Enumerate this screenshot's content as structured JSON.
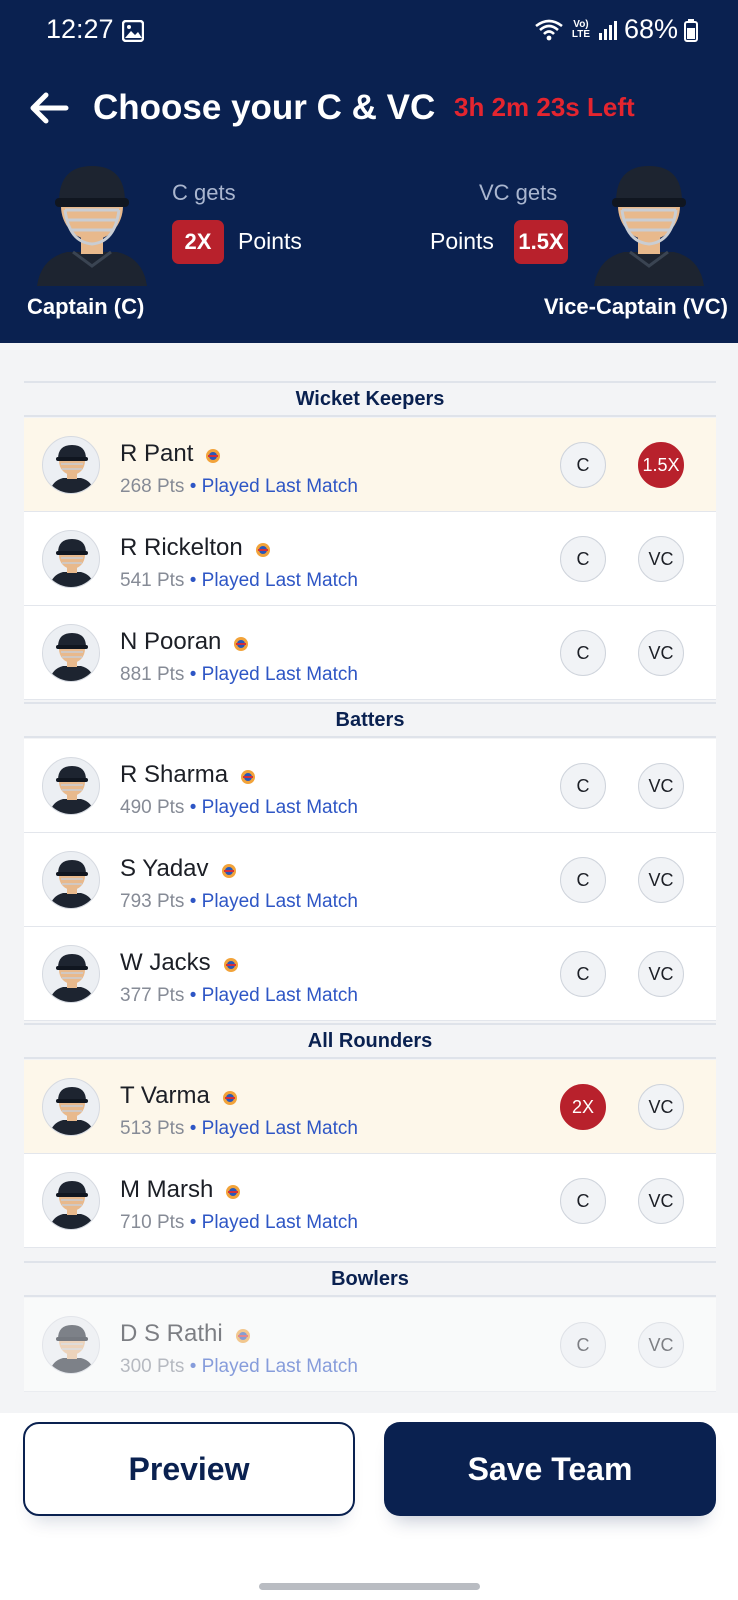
{
  "status_bar": {
    "time": "12:27",
    "battery": "68%",
    "network": "Vo) LTE"
  },
  "header": {
    "title": "Choose your C & VC",
    "timer": "3h 2m 23s Left",
    "captain": {
      "gets_label": "C gets",
      "multiplier": "2X",
      "points_label": "Points",
      "role_label": "Captain (C)"
    },
    "vice_captain": {
      "gets_label": "VC gets",
      "multiplier": "1.5X",
      "points_label": "Points",
      "role_label": "Vice-Captain (VC)"
    }
  },
  "sections": [
    {
      "title": "Wicket Keepers"
    },
    {
      "title": "Batters"
    },
    {
      "title": "All Rounders"
    },
    {
      "title": "Bowlers"
    }
  ],
  "players": [
    {
      "name": "R Pant",
      "pts": "268 Pts",
      "status": "Played Last Match",
      "c_label": "C",
      "vc_label": "1.5X",
      "selected": "vc"
    },
    {
      "name": "R Rickelton",
      "pts": "541 Pts",
      "status": "Played Last Match",
      "c_label": "C",
      "vc_label": "VC",
      "selected": "none"
    },
    {
      "name": "N Pooran",
      "pts": "881 Pts",
      "status": "Played Last Match",
      "c_label": "C",
      "vc_label": "VC",
      "selected": "none"
    },
    {
      "name": "R Sharma",
      "pts": "490 Pts",
      "status": "Played Last Match",
      "c_label": "C",
      "vc_label": "VC",
      "selected": "none"
    },
    {
      "name": "S Yadav",
      "pts": "793 Pts",
      "status": "Played Last Match",
      "c_label": "C",
      "vc_label": "VC",
      "selected": "none"
    },
    {
      "name": "W Jacks",
      "pts": "377 Pts",
      "status": "Played Last Match",
      "c_label": "C",
      "vc_label": "VC",
      "selected": "none"
    },
    {
      "name": "T Varma",
      "pts": "513 Pts",
      "status": "Played Last Match",
      "c_label": "2X",
      "vc_label": "VC",
      "selected": "c"
    },
    {
      "name": "M Marsh",
      "pts": "710 Pts",
      "status": "Played Last Match",
      "c_label": "C",
      "vc_label": "VC",
      "selected": "none"
    },
    {
      "name": "D S Rathi",
      "pts": "300 Pts",
      "status": "Played Last Match",
      "c_label": "C",
      "vc_label": "VC",
      "selected": "none"
    }
  ],
  "footer": {
    "preview_label": "Preview",
    "save_label": "Save Team"
  },
  "colors": {
    "navy": "#0a2150",
    "accent_red": "#b8212c",
    "timer_red": "#e4252f",
    "link_blue": "#2e56c5",
    "selected_row": "#fdf7ea"
  },
  "icons": [
    "back-arrow-icon",
    "gallery-icon",
    "wifi-icon",
    "signal-icon",
    "battery-icon",
    "player-avatar-icon",
    "team-logo-icon"
  ]
}
